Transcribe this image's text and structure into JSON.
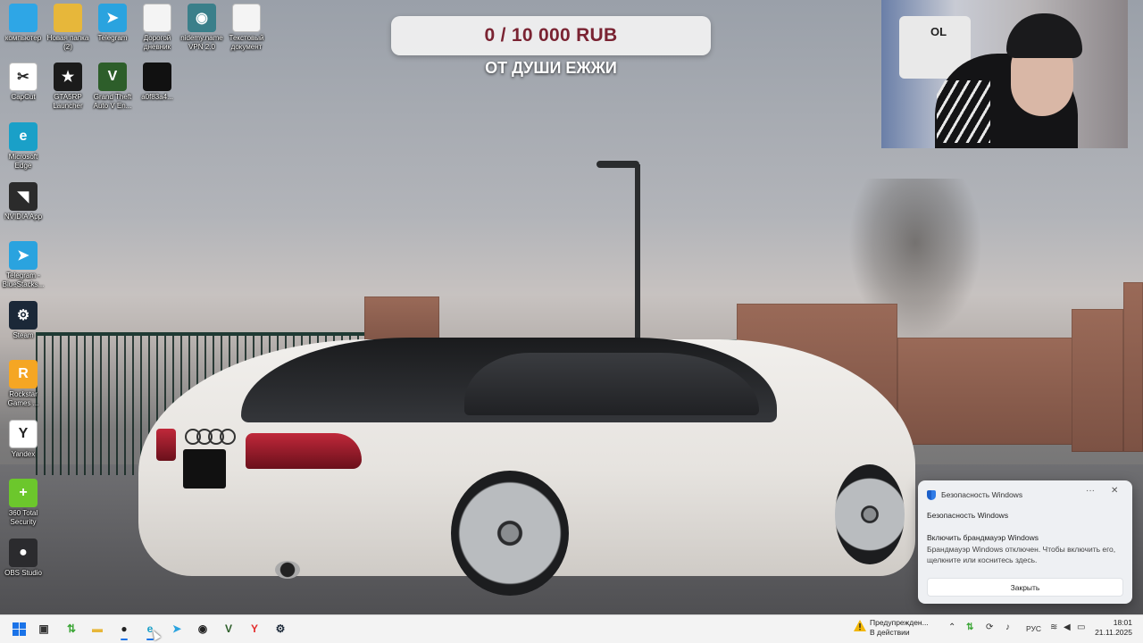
{
  "desktop": {
    "icons": [
      {
        "label": "компьютер",
        "icon": "monitor-icon",
        "color": "#2ea6e6",
        "glyph": ""
      },
      {
        "label": "Новая папка (2)",
        "icon": "folder-icon",
        "color": "#e7b73a",
        "glyph": ""
      },
      {
        "label": "Telegram",
        "icon": "telegram-icon",
        "color": "#2aa3df",
        "glyph": "➤"
      },
      {
        "label": "Дорогой дневник",
        "icon": "document-icon",
        "color": "#f4f4f4",
        "glyph": ""
      },
      {
        "label": "nidemy.name VPN 2.0",
        "icon": "vpn-icon",
        "color": "#3a7f8a",
        "glyph": "◉"
      },
      {
        "label": "Текстовый документ",
        "icon": "document-icon",
        "color": "#f4f4f4",
        "glyph": ""
      },
      {
        "label": "CapCut",
        "icon": "capcut-icon",
        "color": "#ffffff",
        "glyph": "✂"
      },
      {
        "label": "GTA5RP Launcher",
        "icon": "gta5rp-icon",
        "color": "#1b1b1b",
        "glyph": "★"
      },
      {
        "label": "Grand Theft Auto V En...",
        "icon": "gta-v-icon",
        "color": "#2d5e2a",
        "glyph": "V"
      },
      {
        "label": "a0f83a4...",
        "icon": "file-icon",
        "color": "#111111",
        "glyph": ""
      },
      {
        "label": "Microsoft Edge",
        "icon": "edge-icon",
        "color": "#1aa0c8",
        "glyph": "e"
      },
      {
        "label": "NVIDIA App",
        "icon": "nvidia-icon",
        "color": "#2b2b2b",
        "glyph": "◥"
      },
      {
        "label": "Telegram - BlueStacks...",
        "icon": "telegram-icon",
        "color": "#2aa3df",
        "glyph": "➤"
      },
      {
        "label": "Steam",
        "icon": "steam-icon",
        "color": "#1b2838",
        "glyph": "⚙"
      },
      {
        "label": "Rockstar Games ...",
        "icon": "rockstar-icon",
        "color": "#f5a623",
        "glyph": "R"
      },
      {
        "label": "Yandex",
        "icon": "yandex-icon",
        "color": "#ffffff",
        "glyph": "Y"
      },
      {
        "label": "360 Total Security",
        "icon": "360-security-icon",
        "color": "#6cc72c",
        "glyph": "+"
      },
      {
        "label": "OBS Studio",
        "icon": "obs-icon",
        "color": "#2b2b2e",
        "glyph": "●"
      }
    ]
  },
  "overlay": {
    "donation_goal": "0 / 10 000 RUB",
    "donation_sub": "ОТ ДУШИ ЕЖЖИ"
  },
  "webcam": {
    "chair_text": "OL"
  },
  "notification": {
    "header": "Безопасность Windows",
    "more": "···",
    "close": "✕",
    "app": "Безопасность Windows",
    "title": "Включить брандмауэр Windows",
    "body": "Брандмауэр Windows отключен. Чтобы включить его, щелкните или коснитесь здесь.",
    "button": "Закрыть"
  },
  "taskbar": {
    "apps": [
      {
        "icon": "task-view-icon",
        "glyph": "▣",
        "color": "#333333"
      },
      {
        "icon": "torrent-icon",
        "glyph": "⇅",
        "color": "#3aa535"
      },
      {
        "icon": "file-explorer-icon",
        "glyph": "▬",
        "color": "#e7b73a"
      },
      {
        "icon": "obs-icon",
        "glyph": "●",
        "color": "#222222"
      },
      {
        "icon": "edge-icon",
        "glyph": "e",
        "color": "#1aa0c8"
      },
      {
        "icon": "telegram-icon",
        "glyph": "➤",
        "color": "#2aa3df"
      },
      {
        "icon": "vpn-icon",
        "glyph": "◉",
        "color": "#222222"
      },
      {
        "icon": "gta-v-icon",
        "glyph": "V",
        "color": "#2d5e2a"
      },
      {
        "icon": "yandex-icon",
        "glyph": "Y",
        "color": "#e32b2b"
      },
      {
        "icon": "steam-icon",
        "glyph": "⚙",
        "color": "#1b2838"
      }
    ],
    "warning_line1": "Предупрежден...",
    "warning_line2": "В действии",
    "language": "РУС",
    "time": "18:01",
    "date": "21.11.2025"
  }
}
